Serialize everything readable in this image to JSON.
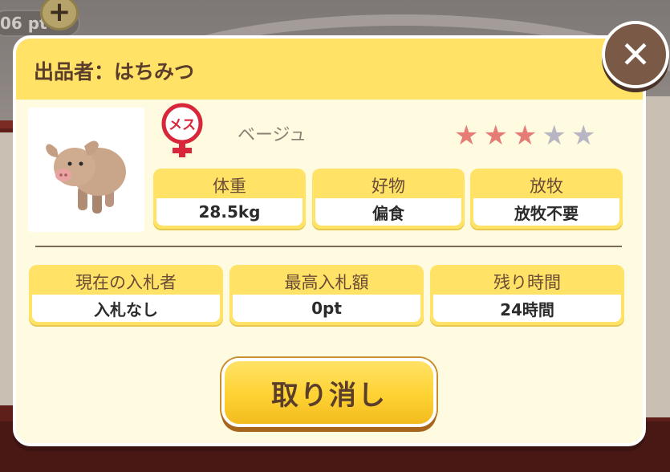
{
  "background": {
    "points_text": "06 pt",
    "plus_icon": "plus-icon"
  },
  "dialog": {
    "header_title": "出品者：はちみつ",
    "close_icon": "close-icon",
    "pig": {
      "image": "pig-icon",
      "gender_label": "メス",
      "color_name": "ベージュ",
      "rating": {
        "value": 3,
        "max": 5
      }
    },
    "stats": [
      {
        "label": "体重",
        "value": "28.5kg"
      },
      {
        "label": "好物",
        "value": "偏食"
      },
      {
        "label": "放牧",
        "value": "放牧不要"
      }
    ],
    "auction": [
      {
        "label": "現在の入札者",
        "value": "入札なし"
      },
      {
        "label": "最高入札額",
        "value": "0pt"
      },
      {
        "label": "残り時間",
        "value": "24時間"
      }
    ],
    "cancel_label": "取り消し"
  },
  "colors": {
    "header_yellow": "#ffe266",
    "panel_bg": "#fffbe0",
    "star_on": "#e57d76",
    "star_off": "#b9b6c4",
    "gender_red": "#d8273a"
  }
}
